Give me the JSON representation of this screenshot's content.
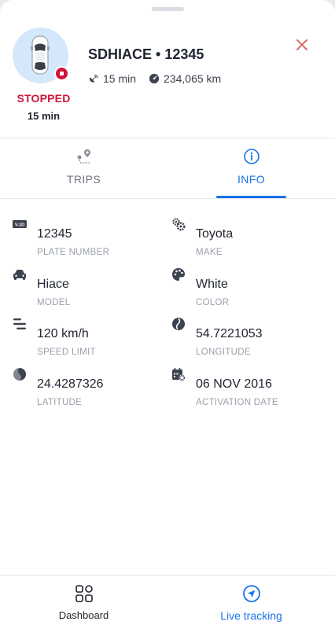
{
  "header": {
    "vehicle_title": "SDHIACE • 12345",
    "status": "STOPPED",
    "status_duration": "15 min",
    "idle_time": "15 min",
    "odometer": "234,065 km",
    "status_color": "#d0163b"
  },
  "tabs": [
    {
      "label": "TRIPS",
      "icon": "route-pin-icon",
      "active": false
    },
    {
      "label": "INFO",
      "icon": "info-circle-icon",
      "active": true
    }
  ],
  "info": {
    "plate_number": {
      "value": "12345",
      "label": "PLATE NUMBER",
      "icon": "license-plate-icon"
    },
    "make": {
      "value": "Toyota",
      "label": "MAKE",
      "icon": "gears-icon"
    },
    "model": {
      "value": "Hiace",
      "label": "MODEL",
      "icon": "car-icon"
    },
    "color": {
      "value": "White",
      "label": "COLOR",
      "icon": "palette-icon"
    },
    "speed_limit": {
      "value": "120 km/h",
      "label": "SPEED LIMIT",
      "icon": "speed-lines-icon"
    },
    "longitude": {
      "value": "54.7221053",
      "label": "LONGITUDE",
      "icon": "globe-icon"
    },
    "latitude": {
      "value": "24.4287326",
      "label": "LATITUDE",
      "icon": "globe-half-icon"
    },
    "activation_date": {
      "value": "06 NOV 2016",
      "label": "ACTIVATION DATE",
      "icon": "calendar-gear-icon"
    }
  },
  "bottom_nav": [
    {
      "label": "Dashboard",
      "icon": "dashboard-icon",
      "active": false
    },
    {
      "label": "Live tracking",
      "icon": "navigation-arrow-icon",
      "active": true
    }
  ],
  "colors": {
    "accent": "#1a73e8",
    "stopped": "#d0163b",
    "close": "#d86a6a"
  }
}
